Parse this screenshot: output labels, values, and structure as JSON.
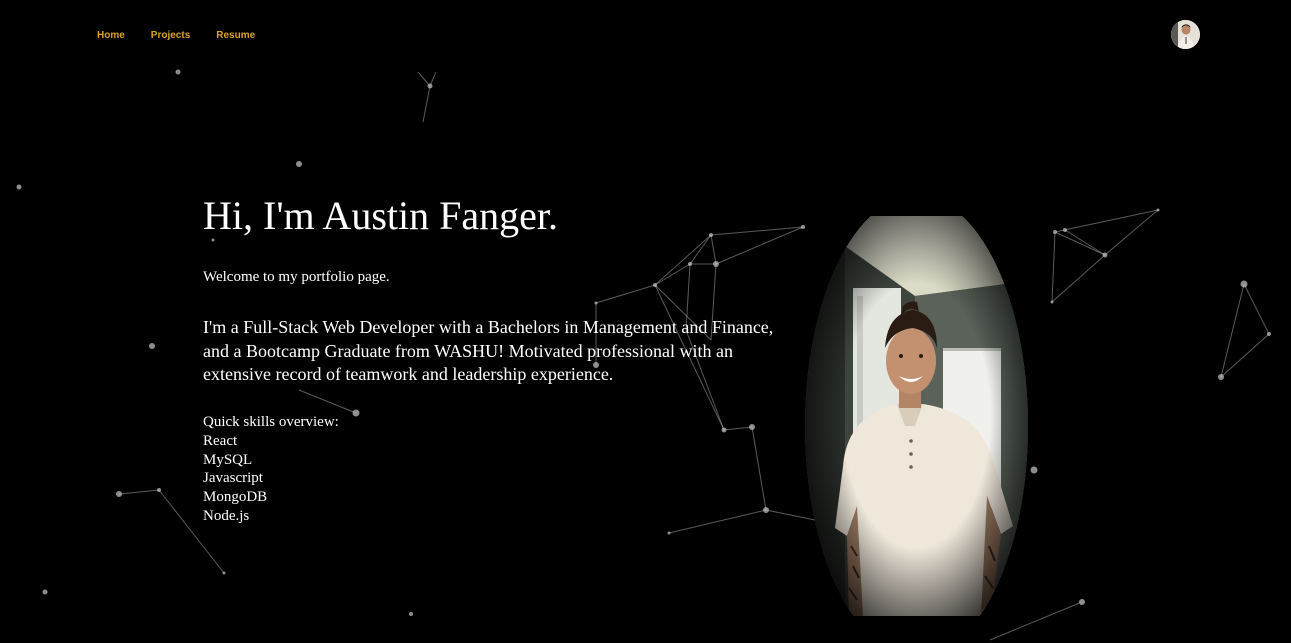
{
  "nav": {
    "links": [
      {
        "label": "Home"
      },
      {
        "label": "Projects"
      },
      {
        "label": "Resume"
      }
    ],
    "avatar_icon": "profile-avatar",
    "accent_color": "#d9a227"
  },
  "hero": {
    "title": "Hi, I'm Austin Fanger.",
    "welcome": "Welcome to my portfolio page.",
    "intro": "I'm a Full-Stack Web Developer with a Bachelors in Management and Finance, and a Bootcamp Graduate from WASHU! Motivated professional with an extensive record of teamwork and leadership experience.",
    "skills_heading": "Quick skills overview:",
    "skills": [
      "React",
      "MySQL",
      "Javascript",
      "MongoDB",
      "Node.js"
    ]
  },
  "portrait": {
    "subject": "smiling man in cream henley shirt standing in a room"
  },
  "background": {
    "color": "#000000",
    "effect": "particle network"
  }
}
